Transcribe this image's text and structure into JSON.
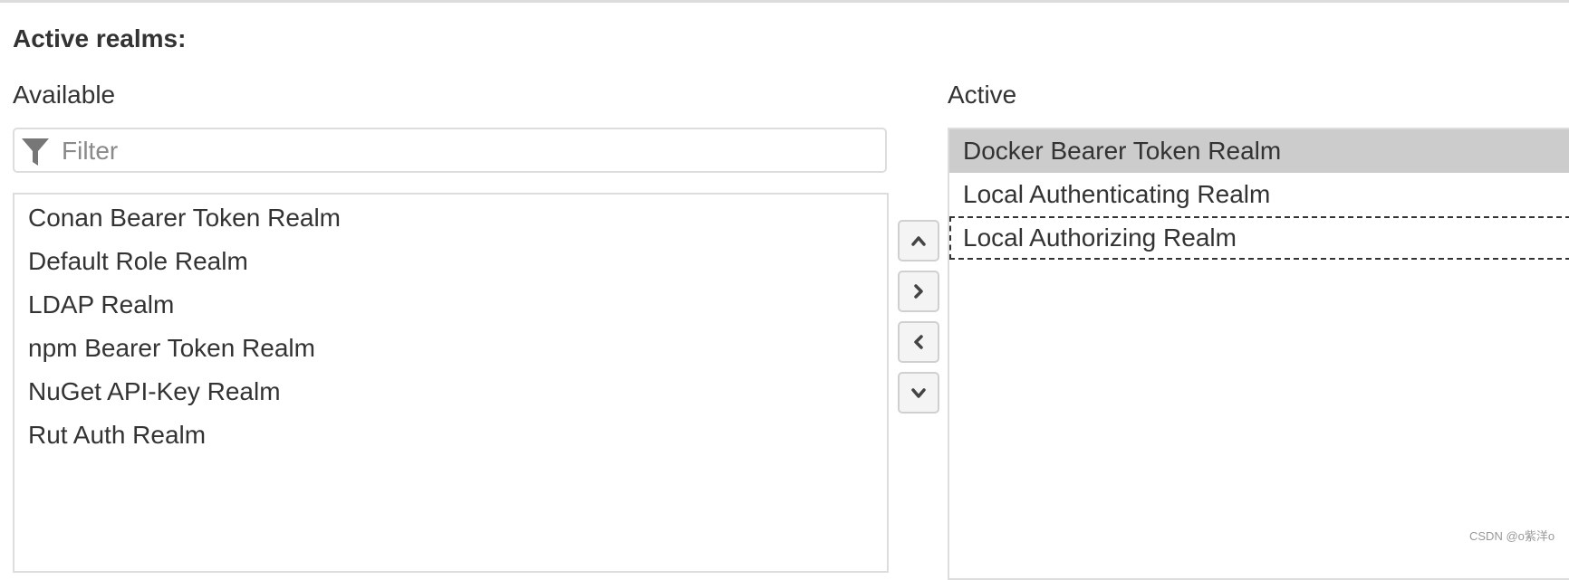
{
  "title": "Active realms:",
  "available": {
    "label": "Available",
    "filter_placeholder": "Filter",
    "filter_value": "",
    "items": [
      "Conan Bearer Token Realm",
      "Default Role Realm",
      "LDAP Realm",
      "npm Bearer Token Realm",
      "NuGet API-Key Realm",
      "Rut Auth Realm"
    ]
  },
  "active": {
    "label": "Active",
    "items": [
      "Docker Bearer Token Realm",
      "Local Authenticating Realm",
      "Local Authorizing Realm"
    ],
    "selected_index": 0,
    "focused_index": 2
  },
  "buttons": {
    "move_up_icon": "chevron-up-icon",
    "add_icon": "chevron-right-icon",
    "remove_icon": "chevron-left-icon",
    "move_down_icon": "chevron-down-icon"
  },
  "watermark": "CSDN @o紫洋o",
  "colors": {
    "selected_row": "#cccccc",
    "border": "#dddddd",
    "text": "#333333"
  }
}
